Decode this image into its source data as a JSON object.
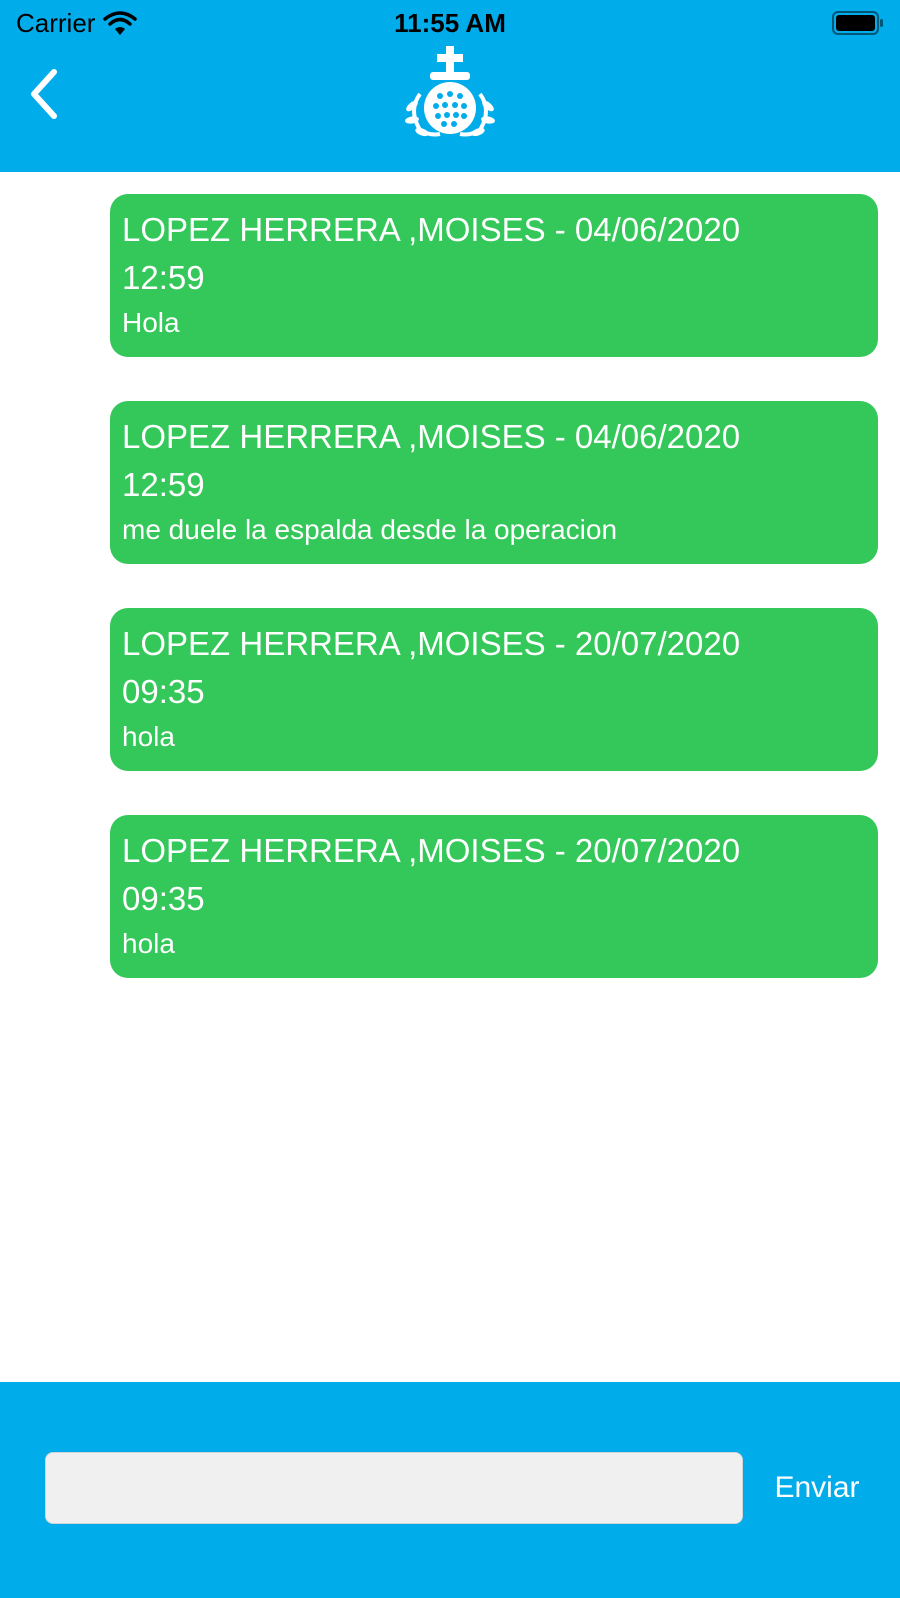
{
  "status_bar": {
    "carrier": "Carrier",
    "time": "11:55 AM"
  },
  "header": {
    "back_icon": "chevron-left-icon",
    "logo_icon": "crest-logo-icon",
    "background_color": "#00ACEA"
  },
  "messages": [
    {
      "meta": "LOPEZ HERRERA ,MOISES - 04/06/2020\n12:59",
      "text": "Hola"
    },
    {
      "meta": "LOPEZ HERRERA ,MOISES - 04/06/2020\n12:59",
      "text": "me duele la espalda desde la operacion"
    },
    {
      "meta": "LOPEZ HERRERA ,MOISES - 20/07/2020\n09:35",
      "text": "hola"
    },
    {
      "meta": "LOPEZ HERRERA ,MOISES - 20/07/2020\n09:35",
      "text": "hola"
    }
  ],
  "bubble_color": "#34C759",
  "composer": {
    "input_value": "",
    "input_placeholder": "",
    "send_label": "Enviar"
  }
}
